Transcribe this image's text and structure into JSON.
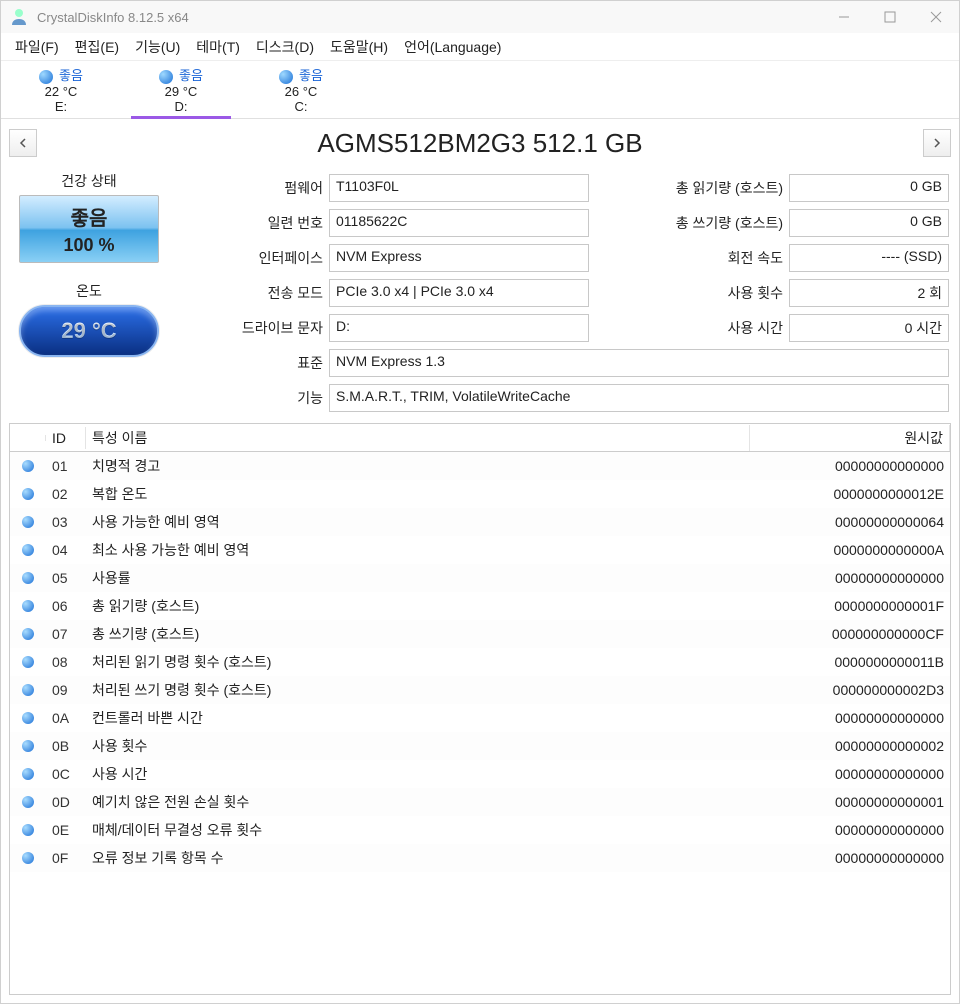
{
  "titlebar": {
    "title": "CrystalDiskInfo 8.12.5 x64"
  },
  "menu": {
    "file": "파일(F)",
    "edit": "편집(E)",
    "function": "기능(U)",
    "theme": "테마(T)",
    "disk": "디스크(D)",
    "help": "도움말(H)",
    "language": "언어(Language)"
  },
  "disk_tabs": [
    {
      "status": "좋음",
      "temp": "22 °C",
      "drive": "E:"
    },
    {
      "status": "좋음",
      "temp": "29 °C",
      "drive": "D:"
    },
    {
      "status": "좋음",
      "temp": "26 °C",
      "drive": "C:"
    }
  ],
  "model": "AGMS512BM2G3 512.1 GB",
  "health": {
    "label": "건강 상태",
    "status": "좋음",
    "pct": "100 %"
  },
  "temp": {
    "label": "온도",
    "value": "29 °C"
  },
  "details": {
    "firmware_lbl": "펌웨어",
    "firmware": "T1103F0L",
    "serial_lbl": "일련 번호",
    "serial": "01185622C",
    "iface_lbl": "인터페이스",
    "iface": "NVM Express",
    "tmode_lbl": "전송 모드",
    "tmode": "PCIe 3.0 x4 | PCIe 3.0 x4",
    "dletter_lbl": "드라이브 문자",
    "dletter": "D:",
    "std_lbl": "표준",
    "std": "NVM Express 1.3",
    "feat_lbl": "기능",
    "feat": "S.M.A.R.T., TRIM, VolatileWriteCache",
    "tread_lbl": "총 읽기량 (호스트)",
    "tread": "0 GB",
    "twrite_lbl": "총 쓰기량 (호스트)",
    "twrite": "0 GB",
    "rpm_lbl": "회전 속도",
    "rpm": "---- (SSD)",
    "poc_lbl": "사용 횟수",
    "poc": "2 회",
    "poh_lbl": "사용 시간",
    "poh": "0 시간"
  },
  "smart_head": {
    "id": "ID",
    "name": "특성 이름",
    "raw": "원시값"
  },
  "smart": [
    {
      "id": "01",
      "name": "치명적 경고",
      "raw": "00000000000000"
    },
    {
      "id": "02",
      "name": "복합 온도",
      "raw": "0000000000012E"
    },
    {
      "id": "03",
      "name": "사용 가능한 예비 영역",
      "raw": "00000000000064"
    },
    {
      "id": "04",
      "name": "최소 사용 가능한 예비 영역",
      "raw": "0000000000000A"
    },
    {
      "id": "05",
      "name": "사용률",
      "raw": "00000000000000"
    },
    {
      "id": "06",
      "name": "총 읽기량 (호스트)",
      "raw": "0000000000001F"
    },
    {
      "id": "07",
      "name": "총 쓰기량 (호스트)",
      "raw": "000000000000CF"
    },
    {
      "id": "08",
      "name": "처리된 읽기 명령 횟수 (호스트)",
      "raw": "0000000000011B"
    },
    {
      "id": "09",
      "name": "처리된 쓰기 명령 횟수 (호스트)",
      "raw": "000000000002D3"
    },
    {
      "id": "0A",
      "name": "컨트롤러 바쁜 시간",
      "raw": "00000000000000"
    },
    {
      "id": "0B",
      "name": "사용 횟수",
      "raw": "00000000000002"
    },
    {
      "id": "0C",
      "name": "사용 시간",
      "raw": "00000000000000"
    },
    {
      "id": "0D",
      "name": "예기치 않은 전원 손실 횟수",
      "raw": "00000000000001"
    },
    {
      "id": "0E",
      "name": "매체/데이터 무결성 오류 횟수",
      "raw": "00000000000000"
    },
    {
      "id": "0F",
      "name": "오류 정보 기록 항목 수",
      "raw": "00000000000000"
    }
  ]
}
